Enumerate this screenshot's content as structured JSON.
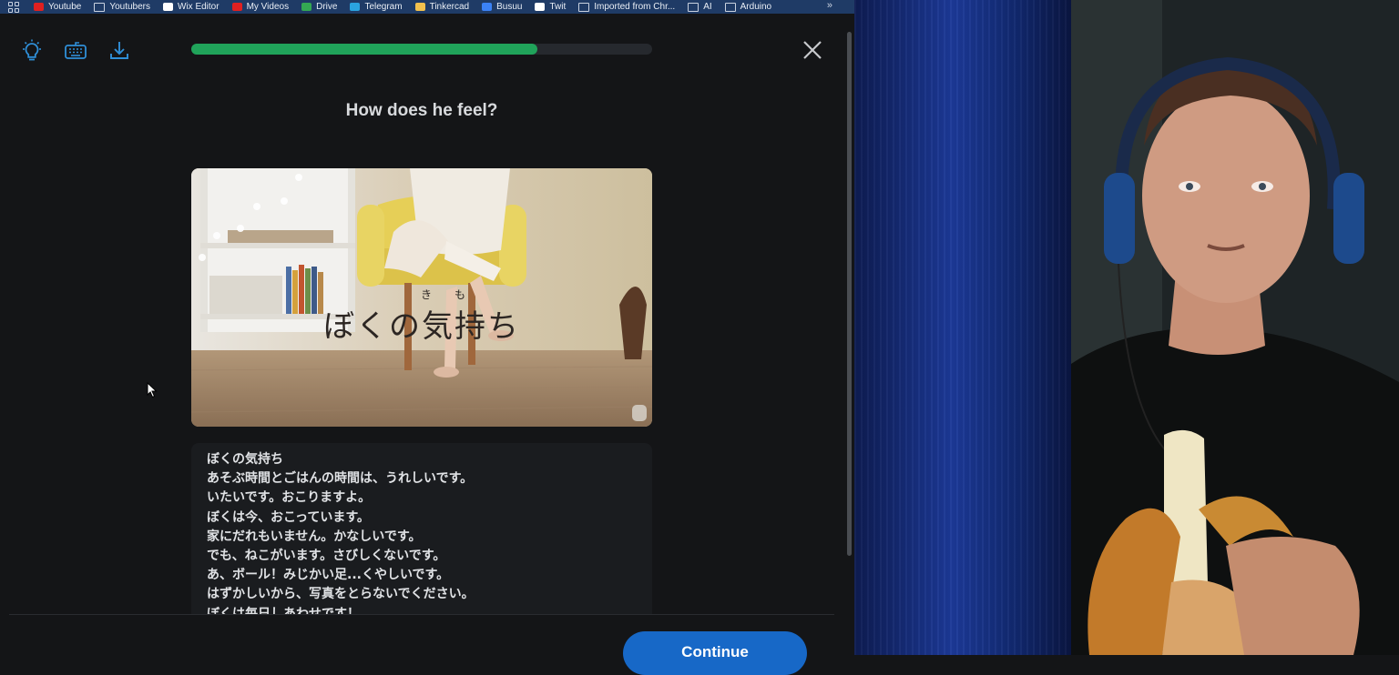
{
  "bookmarks": {
    "items": [
      {
        "label": "Youtube",
        "icon": "youtube-icon",
        "color": "#e02020"
      },
      {
        "label": "Youtubers",
        "icon": "folder-icon",
        "color": ""
      },
      {
        "label": "Wix Editor",
        "icon": "wix-icon",
        "color": "#ffffff"
      },
      {
        "label": "My Videos",
        "icon": "youtube-icon",
        "color": "#e02020"
      },
      {
        "label": "Drive",
        "icon": "drive-icon",
        "color": "#34a853"
      },
      {
        "label": "Telegram",
        "icon": "telegram-icon",
        "color": "#2aa3df"
      },
      {
        "label": "Tinkercad",
        "icon": "tinkercad-icon",
        "color": "#f2c14e"
      },
      {
        "label": "Busuu",
        "icon": "busuu-icon",
        "color": "#3b82f6"
      },
      {
        "label": "Twit",
        "icon": "x-icon",
        "color": "#ffffff"
      },
      {
        "label": "Imported from Chr...",
        "icon": "folder-icon",
        "color": ""
      },
      {
        "label": "AI",
        "icon": "folder-icon",
        "color": ""
      },
      {
        "label": "Arduino",
        "icon": "folder-icon",
        "color": ""
      }
    ],
    "more": "»"
  },
  "lesson": {
    "progress": 0.75,
    "question": "How does he feel?",
    "image_caption": "ぼくの気持ち",
    "ruby": [
      "き",
      "も"
    ],
    "story_lines": [
      "ぼくの気持ち",
      "あそぶ時間とごはんの時間は、うれしいです。",
      "いたいです。おこりますよ。",
      "ぼくは今、おこっています。",
      "家にだれもいません。かなしいです。",
      "でも、ねこがいます。さびしくないです。",
      "あ、ボール！みじかい足...くやしいです。",
      "はずかしいから、写真をとらないでください。",
      "ぼくは毎日しあわせです！"
    ],
    "continue_label": "Continue"
  },
  "colors": {
    "accent_green": "#20a35a",
    "accent_blue": "#1768c7",
    "icon_blue": "#2f8fd8"
  }
}
